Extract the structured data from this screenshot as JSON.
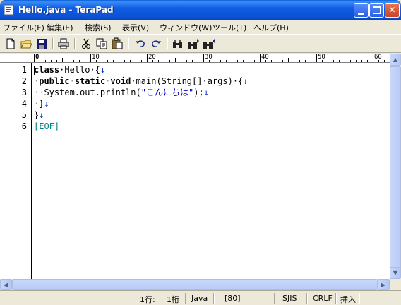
{
  "window": {
    "title": "Hello.java - TeraPad",
    "minimize_glyph": "",
    "close_glyph": "✕"
  },
  "menu": [
    {
      "label": "ファイル(F)"
    },
    {
      "label": "編集(E)"
    },
    {
      "label": "検索(S)"
    },
    {
      "label": "表示(V)"
    },
    {
      "label": "ウィンドウ(W)"
    },
    {
      "label": "ツール(T)"
    },
    {
      "label": "ヘルプ(H)"
    }
  ],
  "ruler": {
    "labels": [
      "0",
      "10",
      "20",
      "30",
      "40",
      "50",
      "60"
    ]
  },
  "editor": {
    "line_numbers": [
      "1",
      "2",
      "3",
      "4",
      "5",
      "6"
    ],
    "lines": {
      "l1_kw": "class",
      "l1_rest": "·Hello·{",
      "l1_mark": "↓",
      "l2_indent": "·",
      "l2_kw1": "public",
      "l2_ws1": "·",
      "l2_kw2": "static",
      "l2_ws2": "·",
      "l2_kw3": "void",
      "l2_rest": "·main(String[]·args)·{",
      "l2_mark": "↓",
      "l3_indent": "··",
      "l3_code": "System.out.println(",
      "l3_str": "\"こんにちは\"",
      "l3_end": ");",
      "l3_mark": "↓",
      "l4_indent": "·",
      "l4_code": "}",
      "l4_mark": "↓",
      "l5_code": "}",
      "l5_mark": "↓",
      "l6_eof": "[EOF]"
    }
  },
  "status": {
    "line": "1行:",
    "column": "1桁",
    "mode": "Java",
    "num": "[80]",
    "encoding": "SJIS",
    "newline": "CRLF",
    "insert": "挿入"
  },
  "colors": {
    "keyword": "#000000",
    "string": "#0000c0",
    "eof": "#008080",
    "titlebar": "#0a5fd6"
  }
}
